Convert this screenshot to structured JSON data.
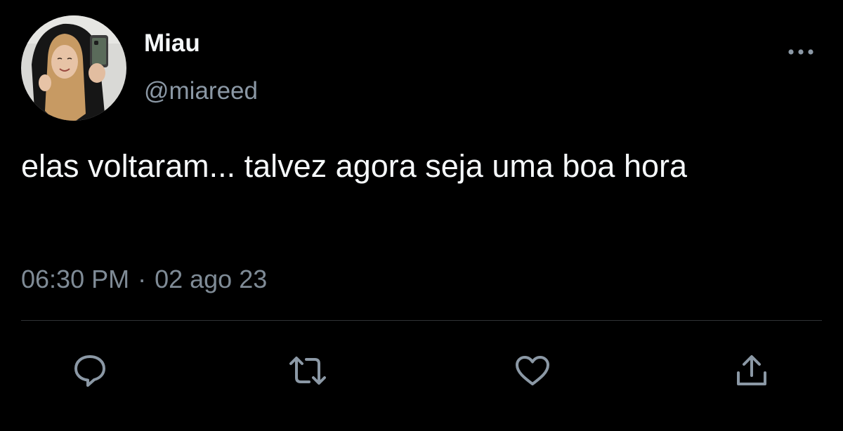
{
  "tweet": {
    "display_name": "Miau",
    "handle": "@miareed",
    "text": "elas voltaram... talvez agora seja uma boa hora",
    "time": "06:30 PM",
    "separator": "·",
    "date": "02 ago 23"
  },
  "icons": {
    "more": "more-horizontal-icon",
    "reply": "reply-icon",
    "retweet": "retweet-icon",
    "like": "heart-icon",
    "share": "share-icon"
  },
  "colors": {
    "background": "#000000",
    "primary_text": "#f5f8fa",
    "secondary_text": "#8b98a5",
    "icon": "#8b98a5",
    "divider": "#2f3336"
  }
}
